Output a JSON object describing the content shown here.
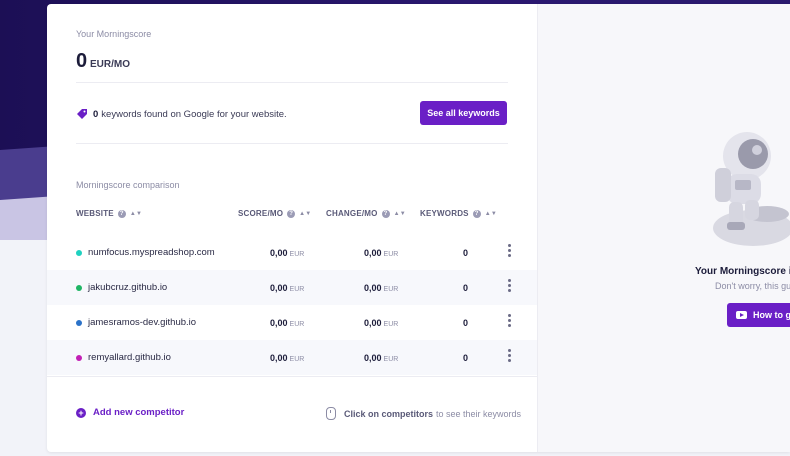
{
  "morningscore": {
    "heading": "Your Morningscore",
    "value": "0",
    "unit": "EUR/MO"
  },
  "keywords": {
    "count": "0",
    "text": "keywords found on Google for your website.",
    "button_label": "See all keywords"
  },
  "comparison": {
    "heading": "Morningscore comparison",
    "columns": {
      "website": "WEBSITE",
      "score": "SCORE/MO",
      "change": "CHANGE/MO",
      "keywords": "KEYWORDS"
    },
    "rows": [
      {
        "site": "numfocus.myspreadshop.com",
        "score": "0,00",
        "score_unit": "EUR",
        "change": "0,00",
        "change_unit": "EUR",
        "keywords": "0",
        "color": "#1fd1c0"
      },
      {
        "site": "jakubcruz.github.io",
        "score": "0,00",
        "score_unit": "EUR",
        "change": "0,00",
        "change_unit": "EUR",
        "keywords": "0",
        "color": "#1fb564"
      },
      {
        "site": "jamesramos-dev.github.io",
        "score": "0,00",
        "score_unit": "EUR",
        "change": "0,00",
        "change_unit": "EUR",
        "keywords": "0",
        "color": "#2b72c8"
      },
      {
        "site": "remyallard.github.io",
        "score": "0,00",
        "score_unit": "EUR",
        "change": "0,00",
        "change_unit": "EUR",
        "keywords": "0",
        "color": "#c21fb5"
      }
    ],
    "add_competitor": "Add new competitor",
    "hint_bold": "Click on competitors",
    "hint_rest": "to see their keywords"
  },
  "right_panel": {
    "title": "Your Morningscore is",
    "subtitle": "Don't worry, this gui",
    "button_label": "How to g"
  },
  "colors": {
    "accent": "#6a1fc6",
    "backdrop": "#2a1870"
  },
  "icons": [
    "tag-icon",
    "help-icon",
    "sort-icon",
    "more-vertical-icon",
    "plus-circle-icon",
    "mouse-icon",
    "youtube-icon",
    "astronaut-illustration"
  ]
}
